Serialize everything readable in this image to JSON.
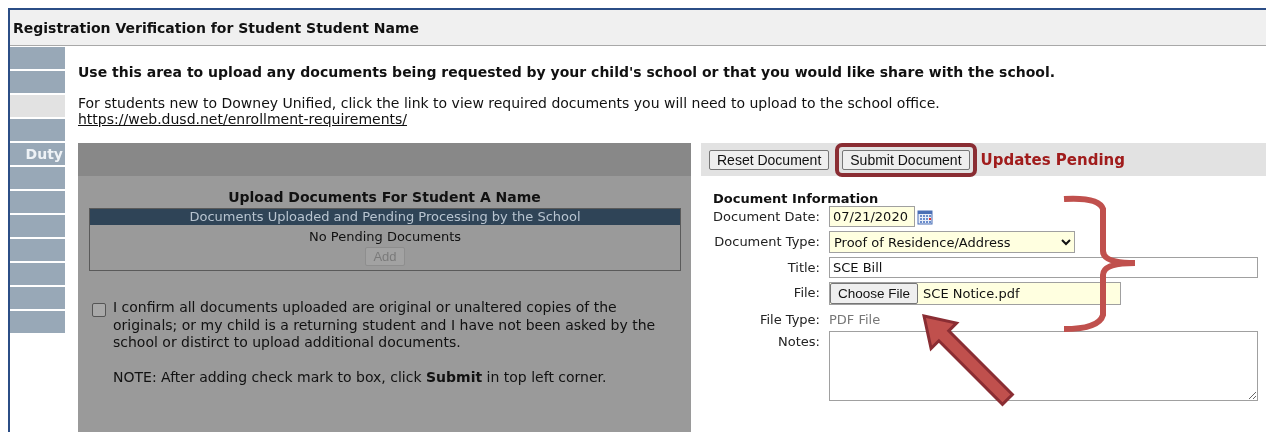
{
  "window": {
    "title": "Registration Verification for Student Student Name"
  },
  "sidebar": {
    "items": [
      {
        "selected": false
      },
      {
        "selected": false
      },
      {
        "selected": true
      },
      {
        "selected": false
      },
      {
        "label": "Duty",
        "selected": false
      },
      {
        "selected": false
      },
      {
        "selected": false
      },
      {
        "selected": false
      },
      {
        "selected": false
      },
      {
        "selected": false
      },
      {
        "selected": false
      },
      {
        "selected": false
      }
    ]
  },
  "intro": {
    "heading": "Use this area to upload any documents being requested by your child's school or that you would like share with the school.",
    "text": "For students new to Downey Unified, click the link to view required documents you will need to upload to the school office.",
    "link": "https://web.dusd.net/enrollment-requirements/"
  },
  "upload_panel": {
    "title": "Upload Documents For Student A Name",
    "table": {
      "header": "Documents Uploaded and Pending Processing by the School",
      "empty_text": "No Pending Documents",
      "add_button": {
        "label": "Add",
        "disabled": true
      }
    },
    "confirm": {
      "checked": false,
      "text": "I confirm all documents uploaded are original or unaltered copies of the originals; or my child is a returning student and I have not been asked by the school or distirct to upload additional documents.",
      "note": "NOTE: After adding check mark to box, click **Submit** in top left corner."
    }
  },
  "document_panel": {
    "buttons": [
      {
        "label": "Reset Document",
        "highlighted": false
      },
      {
        "label": "Submit Document",
        "highlighted": true
      }
    ],
    "status": "Updates Pending",
    "section_title": "Document Information",
    "fields": [
      {
        "kind": "date",
        "label": "Document Date:",
        "value": "07/21/2020"
      },
      {
        "kind": "select",
        "label": "Document Type:",
        "value": "Proof of Residence/Address"
      },
      {
        "kind": "text",
        "label": "Title:",
        "value": "SCE Bill"
      },
      {
        "kind": "file",
        "label": "File:",
        "button_label": "Choose File",
        "value": "SCE Notice.pdf"
      },
      {
        "kind": "readonly",
        "label": "File Type:",
        "value": "PDF File"
      },
      {
        "kind": "textarea",
        "label": "Notes:"
      }
    ]
  }
}
